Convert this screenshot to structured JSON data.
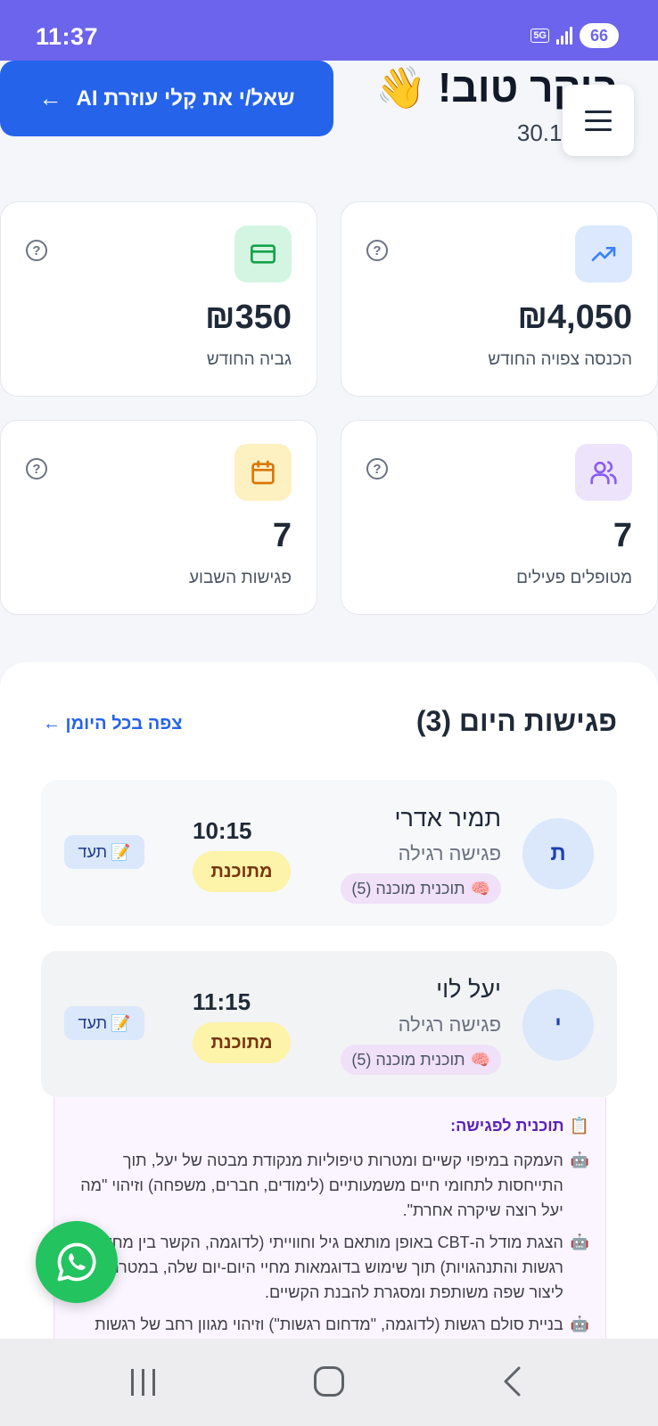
{
  "status_bar": {
    "time": "11:37",
    "network": "5G",
    "battery": "66"
  },
  "header": {
    "greeting": "בוקר טוב! 👋",
    "date": "30.10.2026",
    "ai_button_label": "שאל/י את קָלי עוזרת AI",
    "ai_button_arrow": "←"
  },
  "stats": [
    {
      "value": "₪4,050",
      "label": "הכנסה צפויה החודש",
      "icon": "trending-up-icon",
      "color": "#dbe8fd"
    },
    {
      "value": "₪350",
      "label": "גביה החודש",
      "icon": "credit-card-icon",
      "color": "#d5f5e3"
    },
    {
      "value": "7",
      "label": "מטופלים פעילים",
      "icon": "users-icon",
      "color": "#ede4fb"
    },
    {
      "value": "7",
      "label": "פגישות השבוע",
      "icon": "calendar-icon",
      "color": "#fdf1c2"
    }
  ],
  "help_glyph": "?",
  "today": {
    "title": "פגישות היום (3)",
    "view_all_link": "צפה בכל היומן ←",
    "sessions": [
      {
        "initial": "ת",
        "name": "תמיר אדרי",
        "type": "פגישה רגילה",
        "plan_badge": "תוכנית מוכנה (5)",
        "plan_icon": "🧠",
        "time": "10:15",
        "status": "מתוכנת",
        "doc_label": "תעד",
        "doc_icon": "📝"
      },
      {
        "initial": "י",
        "name": "יעל לוי",
        "type": "פגישה רגילה",
        "plan_badge": "תוכנית מוכנה (5)",
        "plan_icon": "🧠",
        "time": "11:15",
        "status": "מתוכנת",
        "doc_label": "תעד",
        "doc_icon": "📝"
      }
    ]
  },
  "plan": {
    "icon": "📋",
    "title": "תוכנית לפגישה:",
    "bot_icon": "🤖",
    "items": [
      "העמקה במיפוי קשיים ומטרות טיפוליות מנקודת מבטה של יעל, תוך התייחסות לתחומי חיים משמעותיים (לימודים, חברים, משפחה) וזיהוי \"מה יעל רוצה שיקרה אחרת\".",
      "הצגת מודל ה-CBT באופן מותאם גיל וחווייתי (לדוגמה, הקשר בין מחשבות, רגשות והתנהגויות) תוך שימוש בדוגמאות מחיי היום-יום שלה, במטרה ליצור שפה משותפת ומסגרת להבנת הקשיים.",
      "בניית סולם רגשות (לדוגמה, \"מדחום רגשות\") וזיהוי מגוון רחב של רגשות ורמות עוצמה, על מנת להרחיב את אוצר המילים הרגשי של"
    ]
  }
}
